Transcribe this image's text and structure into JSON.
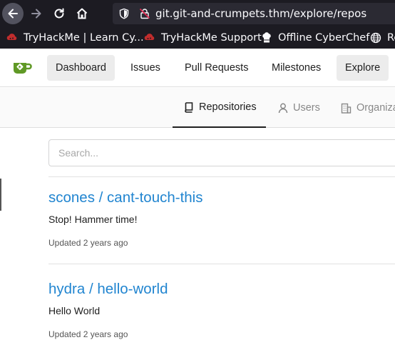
{
  "browser": {
    "url": "git.git-and-crumpets.thm/explore/repos",
    "bookmarks": [
      {
        "label": "TryHackMe | Learn Cy...",
        "icon": "tryhackme-icon"
      },
      {
        "label": "TryHackMe Support",
        "icon": "tryhackme-icon"
      },
      {
        "label": "Offline CyberChef",
        "icon": "chef-hat-icon"
      },
      {
        "label": "Re",
        "icon": "globe-icon"
      }
    ]
  },
  "header": {
    "logo": "gitea-logo-icon",
    "nav": [
      "Dashboard",
      "Issues",
      "Pull Requests",
      "Milestones",
      "Explore"
    ]
  },
  "tabs": {
    "items": [
      {
        "label": "Repositories",
        "icon": "book-icon"
      },
      {
        "label": "Users",
        "icon": "person-icon"
      },
      {
        "label": "Organiza",
        "icon": "organization-icon"
      }
    ]
  },
  "search": {
    "placeholder": "Search..."
  },
  "repos": [
    {
      "title": "scones / cant-touch-this",
      "description": "Stop! Hammer time!",
      "updated": "Updated 2 years ago"
    },
    {
      "title": "hydra / hello-world",
      "description": "Hello World",
      "updated": "Updated 2 years ago"
    }
  ],
  "colors": {
    "link": "#2185d0",
    "gitea_green": "#609926",
    "browser_bg": "#1c1b22",
    "tryhackme_red": "#c12d2d"
  }
}
